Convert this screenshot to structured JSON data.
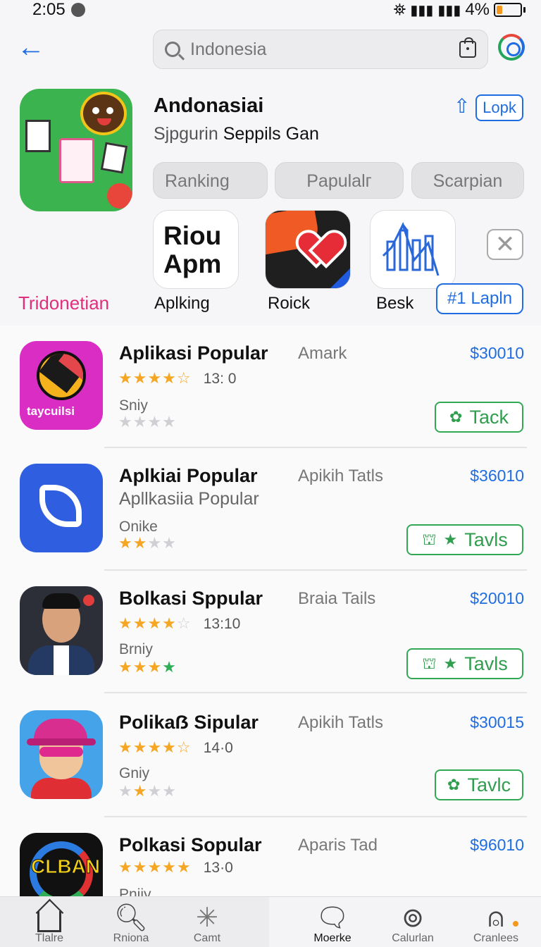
{
  "status_bar": {
    "time": "2:05",
    "battery_text": "4%"
  },
  "search": {
    "placeholder": "Indonesia"
  },
  "app": {
    "title": "Andonasiai",
    "subtitle_a": "Sjpgurin",
    "subtitle_b": "Seppils Gan",
    "top_button": "Lopk"
  },
  "chips": [
    "Ranking",
    "Papulalг",
    "Scarpian"
  ],
  "featured": {
    "brand": "Tridonetian",
    "icon1_text_a": "Riou",
    "icon1_text_b": "Apm",
    "items": [
      "Aplking",
      "Roick",
      "Besk"
    ],
    "cta": "#1 Lapln"
  },
  "apps": [
    {
      "title": "Aplikasi Popular",
      "developer": "Amark",
      "price": "$30010",
      "rating": "13: 0",
      "meta": "Sniy",
      "button": "Tack",
      "icon_text": "taycuilsi"
    },
    {
      "title": "Aplkiai Popular",
      "subtitle": "Apllkasiia Popular",
      "developer": "Apikih Tatls",
      "price": "$36010",
      "meta": "Onike",
      "button": "Tavls"
    },
    {
      "title": "Bolkasi Sppular",
      "developer": "Braia Tails",
      "price": "$20010",
      "rating": "13:10",
      "meta": "Brniy",
      "button": "Tavls"
    },
    {
      "title": "Polikaẞ Sipular",
      "developer": "Apikih Tatls",
      "price": "$30015",
      "rating": "14·0",
      "meta": "Gniy",
      "button": "Tavlc"
    },
    {
      "title": "Polkasi Sopular",
      "developer": "Aparis Tad",
      "price": "$96010",
      "rating": "13·0",
      "meta": "Pniiy",
      "icon_text": "CLBAN"
    }
  ],
  "tabs": [
    "Tlalre",
    "Rniona",
    "Camt",
    "Moerke",
    "Calurlan",
    "Cranlees"
  ]
}
